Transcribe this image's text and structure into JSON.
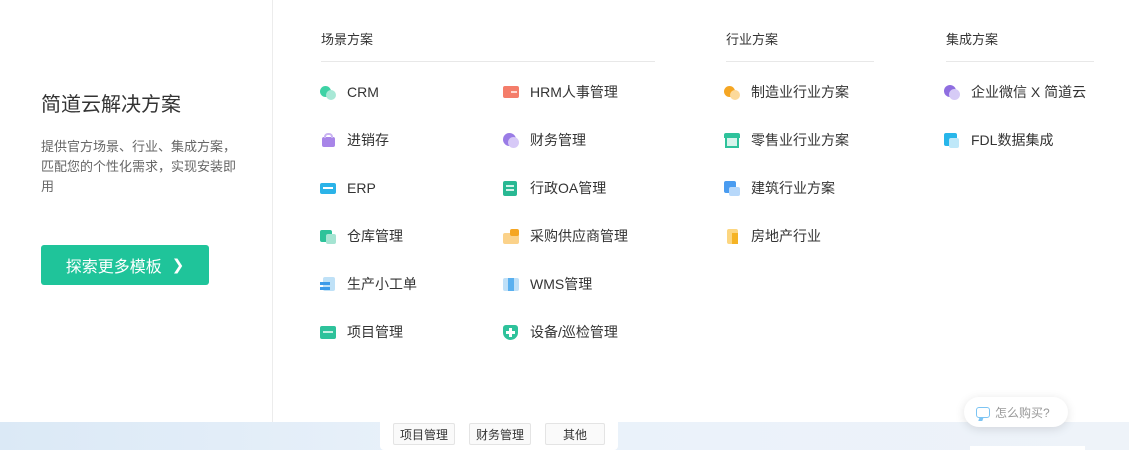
{
  "left": {
    "title": "简道云解决方案",
    "description": "提供官方场景、行业、集成方案，匹配您的个性化需求，实现安装即用",
    "explore_button": "探索更多模板"
  },
  "scene": {
    "title": "场景方案",
    "col1": [
      {
        "label": "CRM",
        "icon": "crm-icon"
      },
      {
        "label": "进销存",
        "icon": "inventory-icon"
      },
      {
        "label": "ERP",
        "icon": "erp-icon"
      },
      {
        "label": "仓库管理",
        "icon": "warehouse-icon"
      },
      {
        "label": "生产小工单",
        "icon": "production-order-icon"
      },
      {
        "label": "项目管理",
        "icon": "project-icon"
      }
    ],
    "col2": [
      {
        "label": "HRM人事管理",
        "icon": "hrm-icon"
      },
      {
        "label": "财务管理",
        "icon": "finance-icon"
      },
      {
        "label": "行政OA管理",
        "icon": "oa-icon"
      },
      {
        "label": "采购供应商管理",
        "icon": "purchase-icon"
      },
      {
        "label": "WMS管理",
        "icon": "wms-icon"
      },
      {
        "label": "设备/巡检管理",
        "icon": "equipment-icon"
      }
    ]
  },
  "industry": {
    "title": "行业方案",
    "items": [
      {
        "label": "制造业行业方案",
        "icon": "manufacturing-icon"
      },
      {
        "label": "零售业行业方案",
        "icon": "retail-icon"
      },
      {
        "label": "建筑行业方案",
        "icon": "construction-icon"
      },
      {
        "label": "房地产行业",
        "icon": "real-estate-icon"
      }
    ]
  },
  "integration": {
    "title": "集成方案",
    "items": [
      {
        "label": "企业微信 X 简道云",
        "icon": "wecom-icon"
      },
      {
        "label": "FDL数据集成",
        "icon": "fdl-icon"
      }
    ]
  },
  "bottom_tabs": [
    "项目管理",
    "财务管理",
    "其他"
  ],
  "ask_button": "怎么购买?",
  "colors": {
    "accent": "#1fc49a",
    "divider": "#e8e8e8"
  }
}
